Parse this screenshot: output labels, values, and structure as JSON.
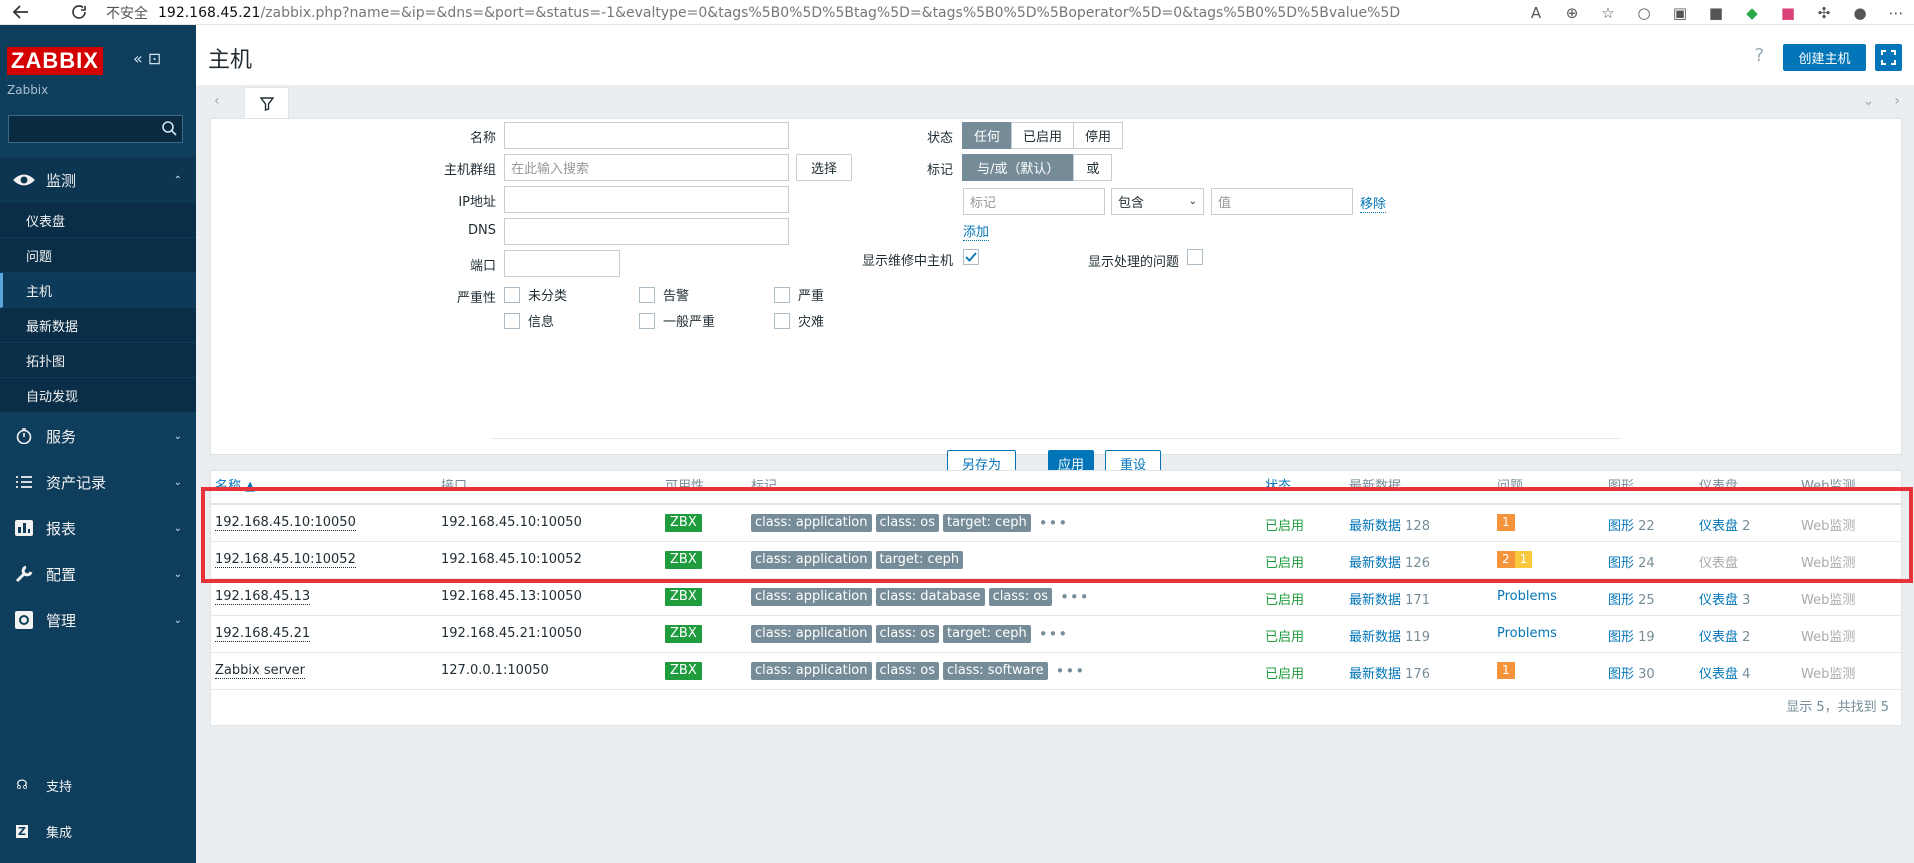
{
  "browser": {
    "security": "不安全",
    "host": "192.168.45.21",
    "path": "/zabbix.php?name=&ip=&dns=&port=&status=-1&evaltype=0&tags%5B0%5D%5Btag%5D=&tags%5B0%5D%5Boperator%5D=0&tags%5B0%5D%5Bvalue%5D=&ma..."
  },
  "sidebar": {
    "logo": "ZABBIX",
    "server": "Zabbix",
    "menu": [
      {
        "label": "监测",
        "open": true,
        "items": [
          "仪表盘",
          "问题",
          "主机",
          "最新数据",
          "拓扑图",
          "自动发现"
        ],
        "active": "主机"
      },
      {
        "label": "服务"
      },
      {
        "label": "资产记录"
      },
      {
        "label": "报表"
      },
      {
        "label": "配置"
      },
      {
        "label": "管理"
      }
    ],
    "footer": [
      "支持",
      "集成"
    ]
  },
  "header": {
    "title": "主机",
    "help": "?",
    "create": "创建主机"
  },
  "filter": {
    "name_label": "名称",
    "group_label": "主机群组",
    "group_placeholder": "在此输入搜索",
    "select": "选择",
    "ip_label": "IP地址",
    "dns_label": "DNS",
    "port_label": "端口",
    "severity_label": "严重性",
    "severities": [
      "未分类",
      "告警",
      "严重",
      "信息",
      "一般严重",
      "灾难"
    ],
    "status_label": "状态",
    "status_opts": [
      "任何",
      "已启用",
      "停用"
    ],
    "tags_label": "标记",
    "tag_ops": [
      "与/或（默认）",
      "或"
    ],
    "tag_placeholder": "标记",
    "operator": "包含",
    "value_placeholder": "值",
    "remove": "移除",
    "add": "添加",
    "maint_label": "显示维修中主机",
    "suppressed_label": "显示处理的问题",
    "save_as": "另存为",
    "apply": "应用",
    "reset": "重设"
  },
  "table": {
    "columns": [
      "名称 ▲",
      "接口",
      "可用性",
      "标记",
      "状态",
      "最新数据",
      "问题",
      "图形",
      "仪表盘",
      "Web监测"
    ],
    "rows": [
      {
        "name": "192.168.45.10:10050",
        "iface": "192.168.45.10:10050",
        "avail": "ZBX",
        "tags": [
          "class: application",
          "class: os",
          "target: ceph"
        ],
        "more": true,
        "status": "已启用",
        "latest": "最新数据",
        "latest_n": "128",
        "problems": [
          {
            "n": "1",
            "color": "#f6943c"
          }
        ],
        "graphs": "图形",
        "graphs_n": "22",
        "dash": "仪表盘",
        "dash_n": "2",
        "web": "Web监测"
      },
      {
        "name": "192.168.45.10:10052",
        "iface": "192.168.45.10:10052",
        "avail": "ZBX",
        "tags": [
          "class: application",
          "target: ceph"
        ],
        "more": false,
        "status": "已启用",
        "latest": "最新数据",
        "latest_n": "126",
        "problems": [
          {
            "n": "2",
            "color": "#f6943c"
          },
          {
            "n": "1",
            "color": "#f8c93e"
          }
        ],
        "graphs": "图形",
        "graphs_n": "24",
        "dash": "仪表盘",
        "dash_n": "",
        "web": "Web监测"
      },
      {
        "name": "192.168.45.13",
        "iface": "192.168.45.13:10050",
        "avail": "ZBX",
        "tags": [
          "class: application",
          "class: database",
          "class: os"
        ],
        "more": true,
        "status": "已启用",
        "latest": "最新数据",
        "latest_n": "171",
        "problems_text": "Problems",
        "graphs": "图形",
        "graphs_n": "25",
        "dash": "仪表盘",
        "dash_n": "3",
        "web": "Web监测"
      },
      {
        "name": "192.168.45.21",
        "iface": "192.168.45.21:10050",
        "avail": "ZBX",
        "tags": [
          "class: application",
          "class: os",
          "target: ceph"
        ],
        "more": true,
        "status": "已启用",
        "latest": "最新数据",
        "latest_n": "119",
        "problems_text": "Problems",
        "graphs": "图形",
        "graphs_n": "19",
        "dash": "仪表盘",
        "dash_n": "2",
        "web": "Web监测"
      },
      {
        "name": "Zabbix server",
        "iface": "127.0.0.1:10050",
        "avail": "ZBX",
        "tags": [
          "class: application",
          "class: os",
          "class: software"
        ],
        "more": true,
        "status": "已启用",
        "latest": "最新数据",
        "latest_n": "176",
        "problems": [
          {
            "n": "1",
            "color": "#f6943c"
          }
        ],
        "graphs": "图形",
        "graphs_n": "30",
        "dash": "仪表盘",
        "dash_n": "4",
        "web": "Web监测"
      }
    ],
    "footer": "显示 5，共找到 5"
  },
  "colors": {
    "sidebar": "#0f3d5c",
    "accent": "#0275b8",
    "highlight": "#e8323a",
    "enabled": "#1f9c3e"
  }
}
